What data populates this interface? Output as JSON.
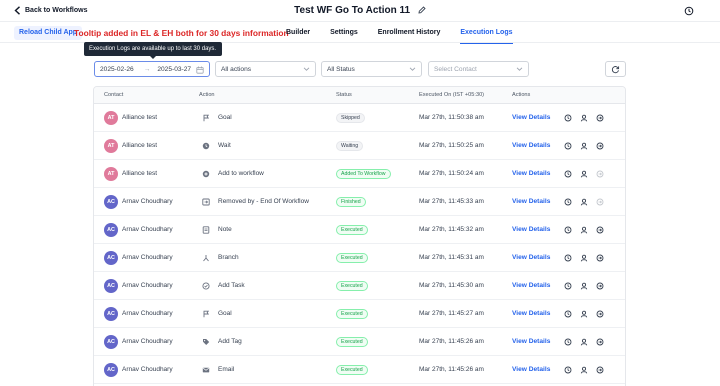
{
  "header": {
    "back_label": "Back to Workflows",
    "title": "Test WF Go To Action 11"
  },
  "subbar": {
    "reload_label": "Reload Child App",
    "notice": "Tooltip added in EL & EH both for 30 days information",
    "tabs": [
      {
        "label": "Builder",
        "active": false
      },
      {
        "label": "Settings",
        "active": false
      },
      {
        "label": "Enrollment History",
        "active": false
      },
      {
        "label": "Execution Logs",
        "active": true
      }
    ]
  },
  "tooltip": "Execution Logs are available up to last 30 days.",
  "filters": {
    "date_from": "2025-02-26",
    "date_to": "2025-03-27",
    "actions": "All actions",
    "status": "All Status",
    "contact_placeholder": "Select Contact"
  },
  "table": {
    "columns": [
      "Contact",
      "Action",
      "Status",
      "Executed On (IST +05:30)",
      "Actions"
    ],
    "view_label": "View Details",
    "rows": [
      {
        "initials": "AT",
        "avatar_color": "#e07a9b",
        "contact": "Alliance test",
        "action": "Goal",
        "action_icon": "flag-icon",
        "status": "Skipped",
        "status_type": "gray",
        "executed_on": "Mar 27th, 11:50:38 am",
        "last_action_enabled": true
      },
      {
        "initials": "AT",
        "avatar_color": "#e07a9b",
        "contact": "Alliance test",
        "action": "Wait",
        "action_icon": "clock-icon",
        "status": "Waiting",
        "status_type": "gray",
        "executed_on": "Mar 27th, 11:50:25 am",
        "last_action_enabled": true
      },
      {
        "initials": "AT",
        "avatar_color": "#e07a9b",
        "contact": "Alliance test",
        "action": "Add to workflow",
        "action_icon": "add-circle-icon",
        "status": "Added To Workflow",
        "status_type": "green",
        "executed_on": "Mar 27th, 11:50:24 am",
        "last_action_enabled": false
      },
      {
        "initials": "AC",
        "avatar_color": "#6366c9",
        "contact": "Arnav Choudhary",
        "action": "Removed by  -  End Of Workflow",
        "action_icon": "end-icon",
        "status": "Finished",
        "status_type": "green",
        "executed_on": "Mar 27th, 11:45:33 am",
        "last_action_enabled": false
      },
      {
        "initials": "AC",
        "avatar_color": "#6366c9",
        "contact": "Arnav Choudhary",
        "action": "Note",
        "action_icon": "note-icon",
        "status": "Executed",
        "status_type": "green",
        "executed_on": "Mar 27th, 11:45:32 am",
        "last_action_enabled": true
      },
      {
        "initials": "AC",
        "avatar_color": "#6366c9",
        "contact": "Arnav Choudhary",
        "action": "Branch",
        "action_icon": "branch-icon",
        "status": "Executed",
        "status_type": "green",
        "executed_on": "Mar 27th, 11:45:31 am",
        "last_action_enabled": true
      },
      {
        "initials": "AC",
        "avatar_color": "#6366c9",
        "contact": "Arnav Choudhary",
        "action": "Add Task",
        "action_icon": "task-icon",
        "status": "Executed",
        "status_type": "green",
        "executed_on": "Mar 27th, 11:45:30 am",
        "last_action_enabled": true
      },
      {
        "initials": "AC",
        "avatar_color": "#6366c9",
        "contact": "Arnav Choudhary",
        "action": "Goal",
        "action_icon": "flag-icon",
        "status": "Executed",
        "status_type": "green",
        "executed_on": "Mar 27th, 11:45:27 am",
        "last_action_enabled": true
      },
      {
        "initials": "AC",
        "avatar_color": "#6366c9",
        "contact": "Arnav Choudhary",
        "action": "Add Tag",
        "action_icon": "tag-icon",
        "status": "Executed",
        "status_type": "green",
        "executed_on": "Mar 27th, 11:45:26 am",
        "last_action_enabled": true
      },
      {
        "initials": "AC",
        "avatar_color": "#6366c9",
        "contact": "Arnav Choudhary",
        "action": "Email",
        "action_icon": "email-icon",
        "status": "Executed",
        "status_type": "green",
        "executed_on": "Mar 27th, 11:45:26 am",
        "last_action_enabled": true
      }
    ]
  },
  "colors": {
    "accent": "#2563eb",
    "notice": "#dc2626",
    "success": "#16a34a"
  }
}
